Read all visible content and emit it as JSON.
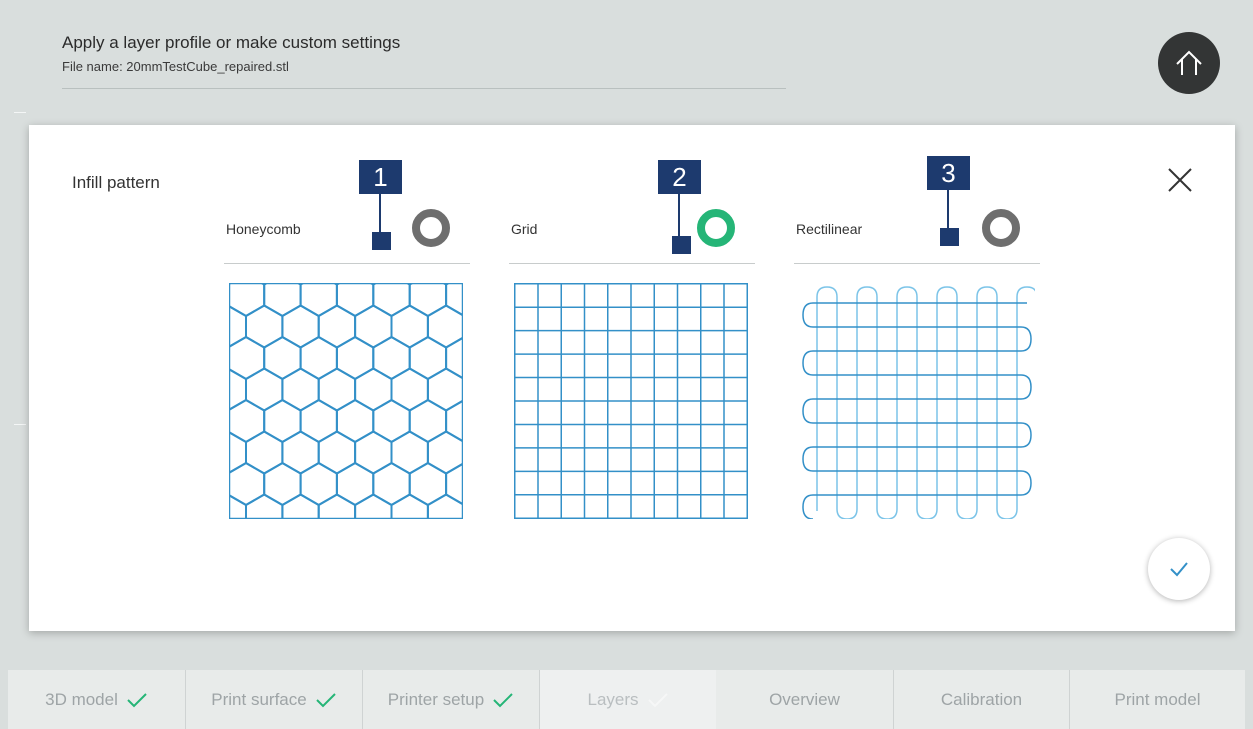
{
  "header": {
    "title": "Apply a layer profile or make custom settings",
    "file_name": "File name: 20mmTestCube_repaired.stl"
  },
  "icons": {
    "home": "home-icon",
    "close": "close-icon",
    "confirm": "checkmark-icon",
    "step_check": "checkmark-icon"
  },
  "colors": {
    "selected": "#25b577",
    "unselected": "#6e6e6e",
    "pattern_stroke": "#3390c8",
    "callout": "#1d3a6e",
    "step_check": "#25b577"
  },
  "dialog": {
    "section_label": "Infill pattern",
    "options": [
      {
        "label": "Honeycomb",
        "selected": false,
        "callout": "1"
      },
      {
        "label": "Grid",
        "selected": true,
        "callout": "2"
      },
      {
        "label": "Rectilinear",
        "selected": false,
        "callout": "3"
      }
    ]
  },
  "steps": [
    {
      "label": "3D model",
      "done": true
    },
    {
      "label": "Print surface",
      "done": true
    },
    {
      "label": "Printer setup",
      "done": true
    },
    {
      "label": "Layers",
      "done": false,
      "current": true
    },
    {
      "label": "Overview",
      "done": false
    },
    {
      "label": "Calibration",
      "done": false
    },
    {
      "label": "Print model",
      "done": false
    }
  ]
}
